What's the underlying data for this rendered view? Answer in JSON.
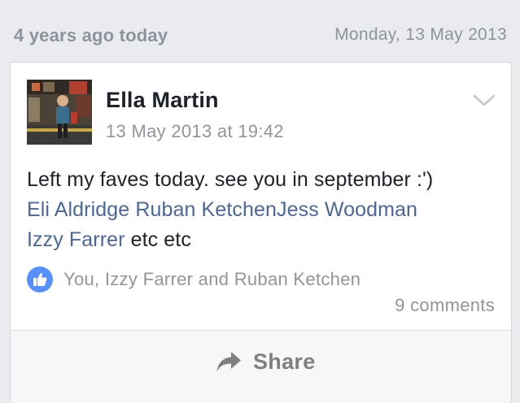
{
  "memory": {
    "label": "4 years ago today",
    "date": "Monday, 13 May 2013"
  },
  "post": {
    "author": "Ella Martin",
    "timestamp": "13 May 2013 at 19:42",
    "text_line1": "Left my faves today. see you in september :')",
    "tags": [
      "Eli Aldridge",
      "Ruban Ketchen",
      "Jess Woodman",
      "Izzy Farrer"
    ],
    "text_suffix": "etc etc"
  },
  "reactions": {
    "icon": "like-icon",
    "names": "You, Izzy Farrer and Ruban Ketchen",
    "comments": "9 comments"
  },
  "actions": {
    "share_label": "Share",
    "share_icon": "share-arrow-icon"
  },
  "colors": {
    "background": "#e9ebee",
    "link": "#4b6798",
    "like_badge": "#5890ff",
    "muted_text": "#90949c"
  }
}
